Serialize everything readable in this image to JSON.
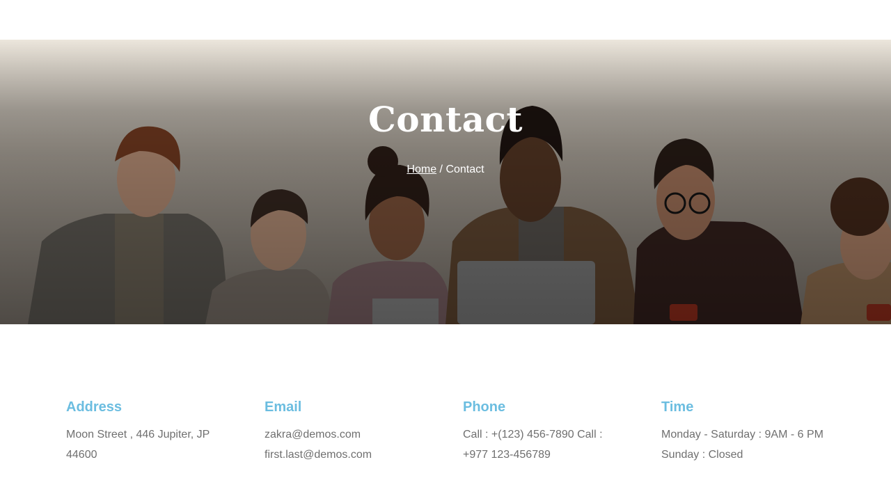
{
  "hero": {
    "title": "Contact",
    "breadcrumb": {
      "home_label": "Home",
      "separator": " / ",
      "current": "Contact"
    }
  },
  "contact_info": {
    "address": {
      "title": "Address",
      "text": "Moon Street , 446 Jupiter, JP 44600"
    },
    "email": {
      "title": "Email",
      "line1": "zakra@demos.com",
      "line2": "first.last@demos.com"
    },
    "phone": {
      "title": "Phone",
      "text": "Call : +(123) 456-7890 Call : +977 123-456789"
    },
    "time": {
      "title": "Time",
      "text": "Monday - Saturday : 9AM - 6 PM Sunday : Closed"
    }
  },
  "colors": {
    "accent": "#6bbde0",
    "body_text": "#6f6f6f",
    "hero_text": "#ffffff"
  }
}
